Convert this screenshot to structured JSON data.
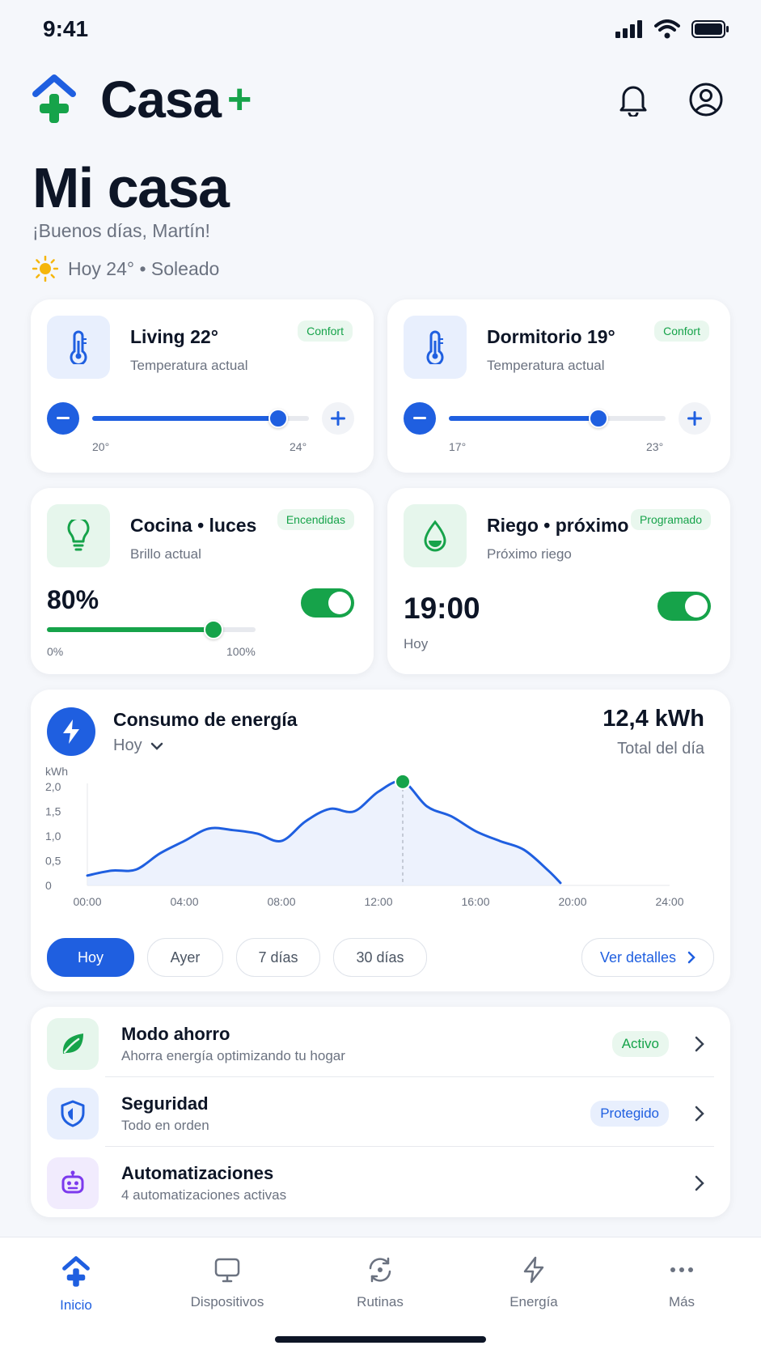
{
  "status": {
    "time": "9:41"
  },
  "brand": {
    "name": "Casa",
    "plus": "+"
  },
  "page": {
    "title": "Mi casa",
    "greeting": "¡Buenos días, Martín!",
    "weather": "Hoy 24° • Soleado"
  },
  "cards": {
    "living": {
      "title": "Living 22°",
      "sub": "Temperatura actual",
      "badge": "Confort",
      "min": "20°",
      "max": "24°",
      "level": 0.86
    },
    "dormitorio": {
      "title": "Dormitorio 19°",
      "sub": "Temperatura actual",
      "badge": "Confort",
      "min": "17°",
      "max": "23°",
      "level": 0.69
    },
    "cocina": {
      "title": "Cocina • luces",
      "sub": "Brillo actual",
      "badge": "Encendidas",
      "value": "80%",
      "min": "0%",
      "max": "100%",
      "level": 0.8,
      "on": true
    },
    "riego": {
      "title": "Riego • próximo",
      "sub": "Próximo riego",
      "badge": "Programado",
      "time": "19:00",
      "day": "Hoy",
      "on": true
    }
  },
  "energy": {
    "title": "Consumo de energía",
    "period": "Hoy",
    "total": "12,4 kWh",
    "total_label": "Total del día",
    "chips": [
      "Hoy",
      "Ayer",
      "7 días",
      "30 días"
    ],
    "details": "Ver detalles"
  },
  "chart_data": {
    "type": "area",
    "ylabel": "kWh",
    "ylim": [
      0,
      2.0
    ],
    "yticks": [
      "2,0",
      "1,5",
      "1,0",
      "0,5",
      "0"
    ],
    "xticks": [
      "00:00",
      "04:00",
      "08:00",
      "12:00",
      "16:00",
      "20:00",
      "24:00"
    ],
    "x": [
      0,
      1,
      2,
      3,
      4,
      5,
      6,
      7,
      8,
      9,
      10,
      11,
      12,
      13,
      14,
      15,
      16,
      17,
      18,
      19,
      19.5
    ],
    "values": [
      0.2,
      0.3,
      0.32,
      0.65,
      0.9,
      1.15,
      1.12,
      1.05,
      0.9,
      1.3,
      1.55,
      1.5,
      1.9,
      2.1,
      1.6,
      1.4,
      1.1,
      0.9,
      0.72,
      0.3,
      0.05
    ],
    "highlight_x": 13,
    "grid": false
  },
  "list": [
    {
      "title": "Modo ahorro",
      "sub": "Ahorra energía optimizando tu hogar",
      "badge": "Activo"
    },
    {
      "title": "Seguridad",
      "sub": "Todo en orden",
      "badge": "Protegido"
    },
    {
      "title": "Automatizaciones",
      "sub": "4 automatizaciones activas",
      "badge": ""
    }
  ],
  "tabs": [
    "Inicio",
    "Dispositivos",
    "Rutinas",
    "Energía",
    "Más"
  ],
  "colors": {
    "primary": "#1f5fe0",
    "green": "#16a34a"
  }
}
